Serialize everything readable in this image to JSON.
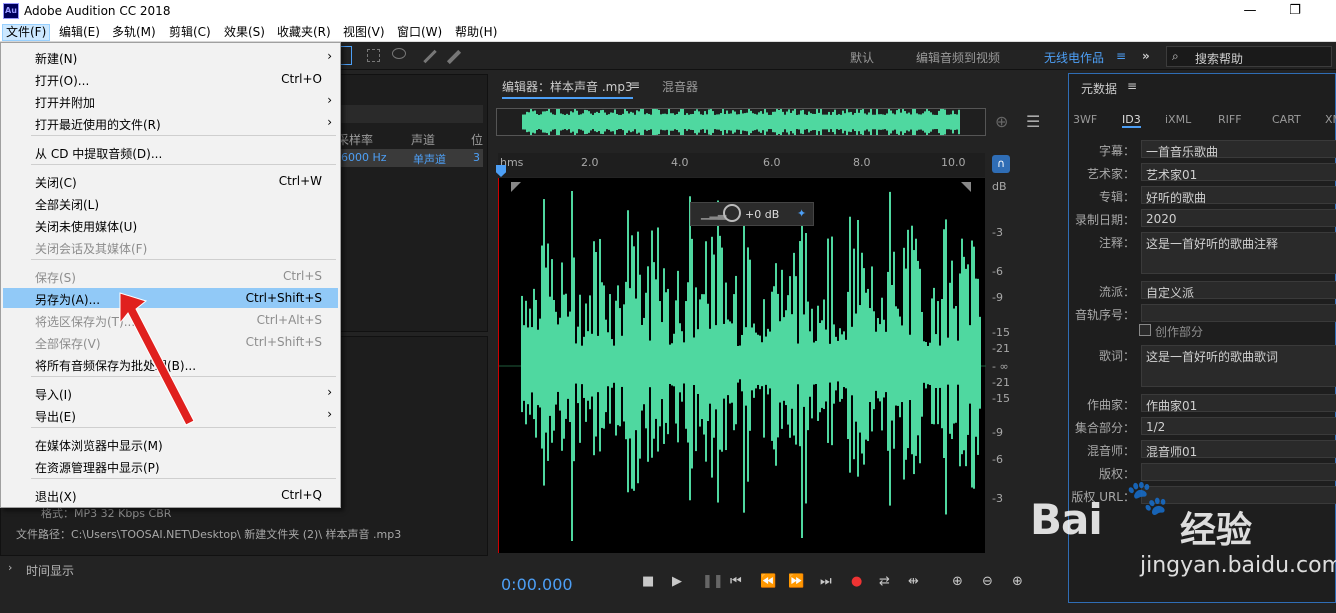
{
  "app": {
    "title": "Adobe Audition CC 2018",
    "logo": "Au"
  },
  "window_controls": {
    "minimize": "—",
    "restore": "❐"
  },
  "menubar": [
    "文件(F)",
    "编辑(E)",
    "多轨(M)",
    "剪辑(C)",
    "效果(S)",
    "收藏夹(R)",
    "视图(V)",
    "窗口(W)",
    "帮助(H)"
  ],
  "workspaces": [
    "默认",
    "编辑音频到视频",
    "无线电作品"
  ],
  "search": {
    "placeholder": "搜索帮助"
  },
  "file_menu": [
    {
      "label": "新建(N)",
      "shortcut": "",
      "submenu": true,
      "enabled": true
    },
    {
      "label": "打开(O)...",
      "shortcut": "Ctrl+O",
      "submenu": false,
      "enabled": true
    },
    {
      "label": "打开并附加",
      "shortcut": "",
      "submenu": true,
      "enabled": true
    },
    {
      "label": "打开最近使用的文件(R)",
      "shortcut": "",
      "submenu": true,
      "enabled": true
    },
    {
      "label": "从 CD 中提取音频(D)...",
      "shortcut": "",
      "submenu": false,
      "enabled": true
    },
    {
      "label": "关闭(C)",
      "shortcut": "Ctrl+W",
      "submenu": false,
      "enabled": true
    },
    {
      "label": "全部关闭(L)",
      "shortcut": "",
      "submenu": false,
      "enabled": true
    },
    {
      "label": "关闭未使用媒体(U)",
      "shortcut": "",
      "submenu": false,
      "enabled": true
    },
    {
      "label": "关闭会话及其媒体(F)",
      "shortcut": "",
      "submenu": false,
      "enabled": false
    },
    {
      "label": "保存(S)",
      "shortcut": "Ctrl+S",
      "submenu": false,
      "enabled": false
    },
    {
      "label": "另存为(A)...",
      "shortcut": "Ctrl+Shift+S",
      "submenu": false,
      "enabled": true,
      "highlighted": true
    },
    {
      "label": "将选区保存为(T)...",
      "shortcut": "Ctrl+Alt+S",
      "submenu": false,
      "enabled": false
    },
    {
      "label": "全部保存(V)",
      "shortcut": "Ctrl+Shift+S",
      "submenu": false,
      "enabled": false
    },
    {
      "label": "将所有音频保存为批处理(B)...",
      "shortcut": "",
      "submenu": false,
      "enabled": true
    },
    {
      "label": "导入(I)",
      "shortcut": "",
      "submenu": true,
      "enabled": true
    },
    {
      "label": "导出(E)",
      "shortcut": "",
      "submenu": true,
      "enabled": true
    },
    {
      "label": "在媒体浏览器中显示(M)",
      "shortcut": "",
      "submenu": false,
      "enabled": true
    },
    {
      "label": "在资源管理器中显示(P)",
      "shortcut": "",
      "submenu": false,
      "enabled": true
    },
    {
      "label": "退出(X)",
      "shortcut": "Ctrl+Q",
      "submenu": false,
      "enabled": true
    }
  ],
  "files_panel": {
    "columns": [
      "采样率",
      "声道",
      "位"
    ],
    "row": {
      "sample_rate": "6000 Hz",
      "channels": "单声道",
      "bits": "3"
    }
  },
  "media_info": {
    "format": "格式：MP3 32 Kbps CBR",
    "path": "文件路径：C:\\Users\\TOOSAI.NET\\Desktop\\ 新建文件夹 (2)\\ 样本声音 .mp3"
  },
  "time_display_label": "时间显示",
  "editor": {
    "tab_label": "编辑器：样本声音 .mp3",
    "mixer_label": "混音器",
    "volume": "+0 dB"
  },
  "ruler": {
    "unit": "hms",
    "ticks": [
      "2.0",
      "4.0",
      "6.0",
      "8.0",
      "10.0"
    ]
  },
  "db_scale": [
    "dB",
    "-3",
    "-6",
    "-9",
    "-15",
    "-21",
    "- ∞",
    "-21",
    "-15",
    "-9",
    "-6",
    "-3"
  ],
  "transport": {
    "time": "0:00.000"
  },
  "metadata": {
    "title": "元数据",
    "tabs": [
      "3WF",
      "ID3",
      "iXML",
      "RIFF",
      "CART",
      "XM"
    ],
    "active_tab": "ID3",
    "fields": [
      {
        "label": "字幕：",
        "value": "一首音乐歌曲"
      },
      {
        "label": "艺术家：",
        "value": "艺术家01"
      },
      {
        "label": "专辑：",
        "value": "好听的歌曲"
      },
      {
        "label": "录制日期：",
        "value": "2020"
      },
      {
        "label": "注释：",
        "value": "这是一首好听的歌曲注释"
      },
      {
        "label": "流派：",
        "value": "自定义派"
      },
      {
        "label": "音轨序号：",
        "value": ""
      },
      {
        "label": "歌词：",
        "value": "这是一首好听的歌曲歌词"
      },
      {
        "label": "作曲家：",
        "value": "作曲家01"
      },
      {
        "label": "集合部分：",
        "value": "1/2"
      },
      {
        "label": "混音师：",
        "value": "混音师01"
      },
      {
        "label": "版权：",
        "value": ""
      },
      {
        "label": "版权 URL：",
        "value": ""
      }
    ],
    "compilation_label": "创作部分"
  },
  "watermark": {
    "brand": "Bai",
    "cn": "经验",
    "url": "jingyan.baidu.com"
  },
  "colors": {
    "waveform": "#4fd8a0",
    "accent": "#4d9ff5",
    "menu_highlight": "#91c9f7",
    "arrow": "#e0201e"
  }
}
